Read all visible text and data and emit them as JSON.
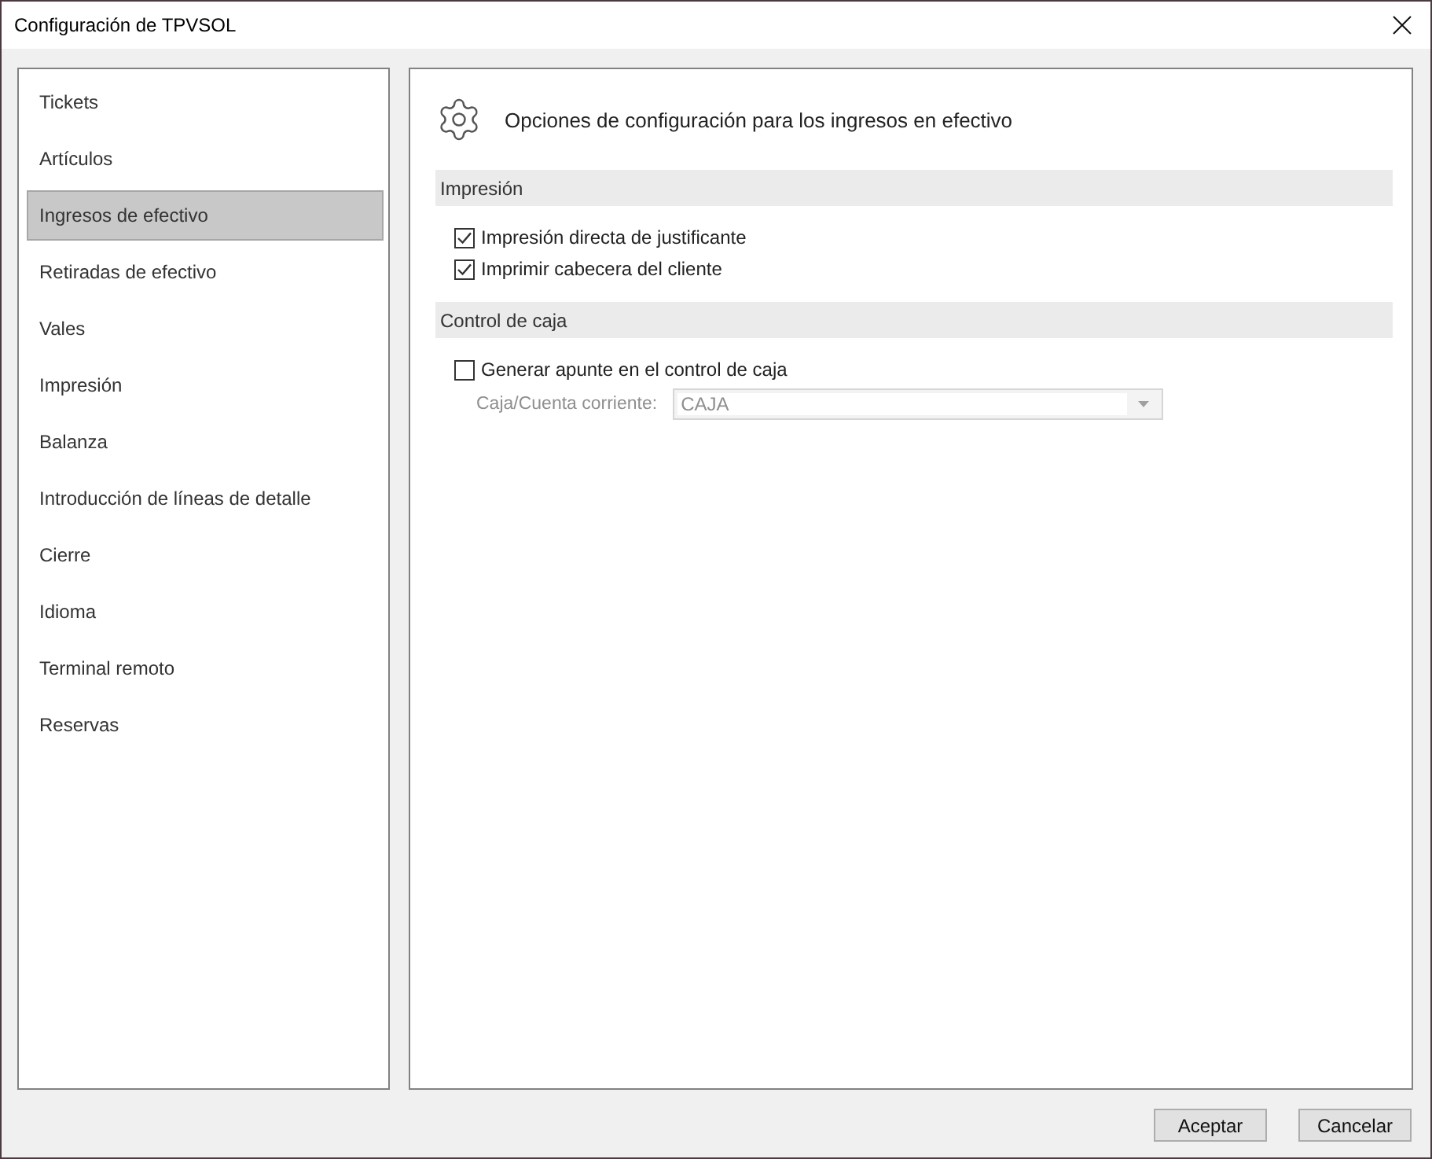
{
  "window": {
    "title": "Configuración de TPVSOL"
  },
  "sidebar": {
    "items": [
      {
        "label": "Tickets",
        "selected": false
      },
      {
        "label": "Artículos",
        "selected": false
      },
      {
        "label": "Ingresos de efectivo",
        "selected": true
      },
      {
        "label": "Retiradas de efectivo",
        "selected": false
      },
      {
        "label": "Vales",
        "selected": false
      },
      {
        "label": "Impresión",
        "selected": false
      },
      {
        "label": "Balanza",
        "selected": false
      },
      {
        "label": "Introducción de líneas de detalle",
        "selected": false
      },
      {
        "label": "Cierre",
        "selected": false
      },
      {
        "label": "Idioma",
        "selected": false
      },
      {
        "label": "Terminal remoto",
        "selected": false
      },
      {
        "label": "Reservas",
        "selected": false
      }
    ]
  },
  "content": {
    "heading": "Opciones de configuración para los ingresos en efectivo",
    "sections": [
      {
        "title": "Impresión",
        "options": [
          {
            "kind": "checkbox",
            "label": "Impresión directa de justificante",
            "checked": true
          },
          {
            "kind": "checkbox",
            "label": "Imprimir cabecera del cliente",
            "checked": true
          }
        ]
      },
      {
        "title": "Control de caja",
        "options": [
          {
            "kind": "checkbox",
            "label": "Generar apunte en el control de caja",
            "checked": false
          },
          {
            "kind": "combo",
            "label": "Caja/Cuenta corriente:",
            "value": "CAJA",
            "disabled": true
          }
        ]
      }
    ]
  },
  "buttons": [
    "Aceptar",
    "Cancelar"
  ]
}
